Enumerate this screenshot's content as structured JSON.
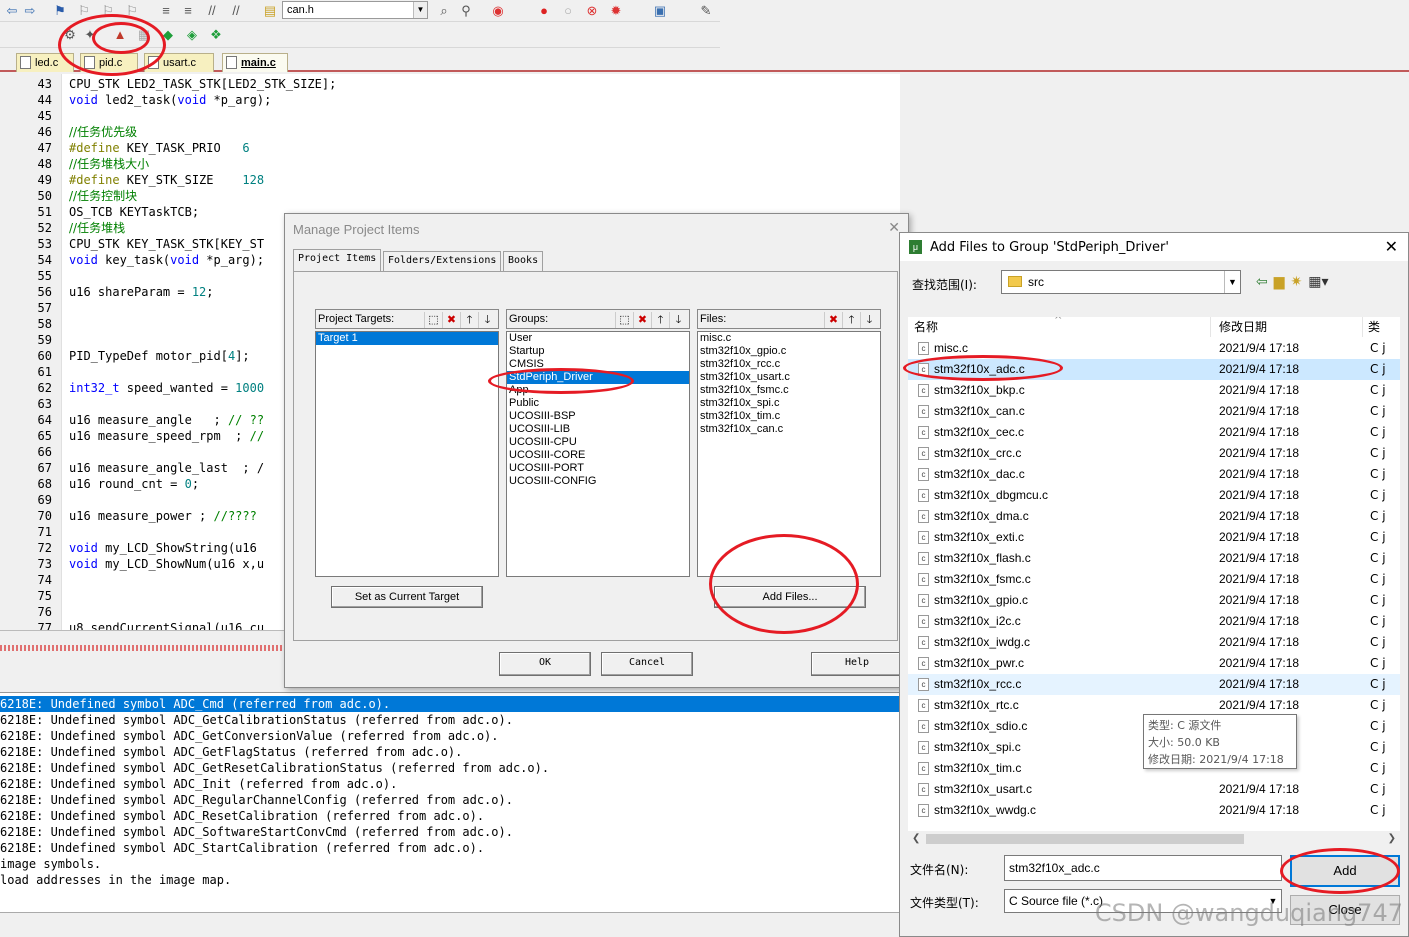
{
  "toolbar": {
    "file_combo": "can.h"
  },
  "tabs": [
    "led.c",
    "pid.c",
    "usart.c",
    "main.c"
  ],
  "active_tab": "main.c",
  "editor": {
    "lines": [
      {
        "n": "43",
        "t": "CPU_STK LED2_TASK_STK[LED2_STK_SIZE];"
      },
      {
        "n": "44",
        "t": "void led2_task(void *p_arg);"
      },
      {
        "n": "45",
        "t": ""
      },
      {
        "n": "46",
        "t": "//任务优先级"
      },
      {
        "n": "47",
        "t": "#define KEY_TASK_PRIO   6"
      },
      {
        "n": "48",
        "t": "//任务堆栈大小"
      },
      {
        "n": "49",
        "t": "#define KEY_STK_SIZE    128"
      },
      {
        "n": "50",
        "t": "//任务控制块"
      },
      {
        "n": "51",
        "t": "OS_TCB KEYTaskTCB;"
      },
      {
        "n": "52",
        "t": "//任务堆栈"
      },
      {
        "n": "53",
        "t": "CPU_STK KEY_TASK_STK[KEY_ST"
      },
      {
        "n": "54",
        "t": "void key_task(void *p_arg);"
      },
      {
        "n": "55",
        "t": ""
      },
      {
        "n": "56",
        "t": "u16 shareParam = 12;"
      },
      {
        "n": "57",
        "t": ""
      },
      {
        "n": "58",
        "t": ""
      },
      {
        "n": "59",
        "t": ""
      },
      {
        "n": "60",
        "t": "PID_TypeDef motor_pid[4];"
      },
      {
        "n": "61",
        "t": ""
      },
      {
        "n": "62",
        "t": "int32_t speed_wanted = 1000"
      },
      {
        "n": "63",
        "t": ""
      },
      {
        "n": "64",
        "t": "u16 measure_angle   ; // ??"
      },
      {
        "n": "65",
        "t": "u16 measure_speed_rpm  ; //"
      },
      {
        "n": "66",
        "t": ""
      },
      {
        "n": "67",
        "t": "u16 measure_angle_last  ; /"
      },
      {
        "n": "68",
        "t": "u16 round_cnt = 0;"
      },
      {
        "n": "69",
        "t": ""
      },
      {
        "n": "70",
        "t": "u16 measure_power ; //????"
      },
      {
        "n": "71",
        "t": ""
      },
      {
        "n": "72",
        "t": "void my_LCD_ShowString(u16"
      },
      {
        "n": "73",
        "t": "void my_LCD_ShowNum(u16 x,u"
      },
      {
        "n": "74",
        "t": ""
      },
      {
        "n": "75",
        "t": ""
      },
      {
        "n": "76",
        "t": ""
      },
      {
        "n": "77",
        "t": "u8 sendCurrentSignal(u16 cu"
      }
    ]
  },
  "output": {
    "lines": [
      "6218E: Undefined symbol ADC_Cmd (referred from adc.o).",
      "6218E: Undefined symbol ADC_GetCalibrationStatus (referred from adc.o).",
      "6218E: Undefined symbol ADC_GetConversionValue (referred from adc.o).",
      "6218E: Undefined symbol ADC_GetFlagStatus (referred from adc.o).",
      "6218E: Undefined symbol ADC_GetResetCalibrationStatus (referred from adc.o).",
      "6218E: Undefined symbol ADC_Init (referred from adc.o).",
      "6218E: Undefined symbol ADC_RegularChannelConfig (referred from adc.o).",
      "6218E: Undefined symbol ADC_ResetCalibration (referred from adc.o).",
      "6218E: Undefined symbol ADC_SoftwareStartConvCmd (referred from adc.o).",
      "6218E: Undefined symbol ADC_StartCalibration (referred from adc.o).",
      "image symbols.",
      "load addresses in the image map."
    ]
  },
  "manage": {
    "title": "Manage Project Items",
    "tabs": [
      "Project Items",
      "Folders/Extensions",
      "Books"
    ],
    "targets_label": "Project Targets:",
    "targets": [
      "Target 1"
    ],
    "groups_label": "Groups:",
    "groups": [
      "User",
      "Startup",
      "CMSIS",
      "StdPeriph_Driver",
      "App",
      "Public",
      "UCOSIII-BSP",
      "UCOSIII-LIB",
      "UCOSIII-CPU",
      "UCOSIII-CORE",
      "UCOSIII-PORT",
      "UCOSIII-CONFIG"
    ],
    "selected_group": "StdPeriph_Driver",
    "files_label": "Files:",
    "files": [
      "misc.c",
      "stm32f10x_gpio.c",
      "stm32f10x_rcc.c",
      "stm32f10x_usart.c",
      "stm32f10x_fsmc.c",
      "stm32f10x_spi.c",
      "stm32f10x_tim.c",
      "stm32f10x_can.c"
    ],
    "set_current_label": "Set as Current Target",
    "add_files_label": "Add Files...",
    "ok_label": "OK",
    "cancel_label": "Cancel",
    "help_label": "Help"
  },
  "addfiles": {
    "title": "Add Files to Group 'StdPeriph_Driver'",
    "lookin_label": "查找范围(I):",
    "lookin_value": "src",
    "col_name": "名称",
    "col_date": "修改日期",
    "col_type": "类",
    "files": [
      {
        "name": "misc.c",
        "date": "2021/9/4 17:18",
        "type": "C j"
      },
      {
        "name": "stm32f10x_adc.c",
        "date": "2021/9/4 17:18",
        "type": "C j"
      },
      {
        "name": "stm32f10x_bkp.c",
        "date": "2021/9/4 17:18",
        "type": "C j"
      },
      {
        "name": "stm32f10x_can.c",
        "date": "2021/9/4 17:18",
        "type": "C j"
      },
      {
        "name": "stm32f10x_cec.c",
        "date": "2021/9/4 17:18",
        "type": "C j"
      },
      {
        "name": "stm32f10x_crc.c",
        "date": "2021/9/4 17:18",
        "type": "C j"
      },
      {
        "name": "stm32f10x_dac.c",
        "date": "2021/9/4 17:18",
        "type": "C j"
      },
      {
        "name": "stm32f10x_dbgmcu.c",
        "date": "2021/9/4 17:18",
        "type": "C j"
      },
      {
        "name": "stm32f10x_dma.c",
        "date": "2021/9/4 17:18",
        "type": "C j"
      },
      {
        "name": "stm32f10x_exti.c",
        "date": "2021/9/4 17:18",
        "type": "C j"
      },
      {
        "name": "stm32f10x_flash.c",
        "date": "2021/9/4 17:18",
        "type": "C j"
      },
      {
        "name": "stm32f10x_fsmc.c",
        "date": "2021/9/4 17:18",
        "type": "C j"
      },
      {
        "name": "stm32f10x_gpio.c",
        "date": "2021/9/4 17:18",
        "type": "C j"
      },
      {
        "name": "stm32f10x_i2c.c",
        "date": "2021/9/4 17:18",
        "type": "C j"
      },
      {
        "name": "stm32f10x_iwdg.c",
        "date": "2021/9/4 17:18",
        "type": "C j"
      },
      {
        "name": "stm32f10x_pwr.c",
        "date": "2021/9/4 17:18",
        "type": "C j"
      },
      {
        "name": "stm32f10x_rcc.c",
        "date": "2021/9/4 17:18",
        "type": "C j"
      },
      {
        "name": "stm32f10x_rtc.c",
        "date": "2021/9/4 17:18",
        "type": "C j"
      },
      {
        "name": "stm32f10x_sdio.c",
        "date": "",
        "type": "C j"
      },
      {
        "name": "stm32f10x_spi.c",
        "date": "",
        "type": "C j"
      },
      {
        "name": "stm32f10x_tim.c",
        "date": "",
        "type": "C j"
      },
      {
        "name": "stm32f10x_usart.c",
        "date": "2021/9/4 17:18",
        "type": "C j"
      },
      {
        "name": "stm32f10x_wwdg.c",
        "date": "2021/9/4 17:18",
        "type": "C j"
      }
    ],
    "selected_file": "stm32f10x_adc.c",
    "tooltip": {
      "type": "类型: C 源文件",
      "size": "大小: 50.0 KB",
      "modified": "修改日期: 2021/9/4 17:18"
    },
    "filename_label": "文件名(N):",
    "filename_value": "stm32f10x_adc.c",
    "filetype_label": "文件类型(T):",
    "filetype_value": "C Source file (*.c)",
    "add_label": "Add",
    "close_label": "Close"
  },
  "watermark": "CSDN @wangduqiang747",
  "colors": {
    "selection": "#0078d7",
    "annotation": "#e51b24",
    "hover": "#cce8ff"
  }
}
